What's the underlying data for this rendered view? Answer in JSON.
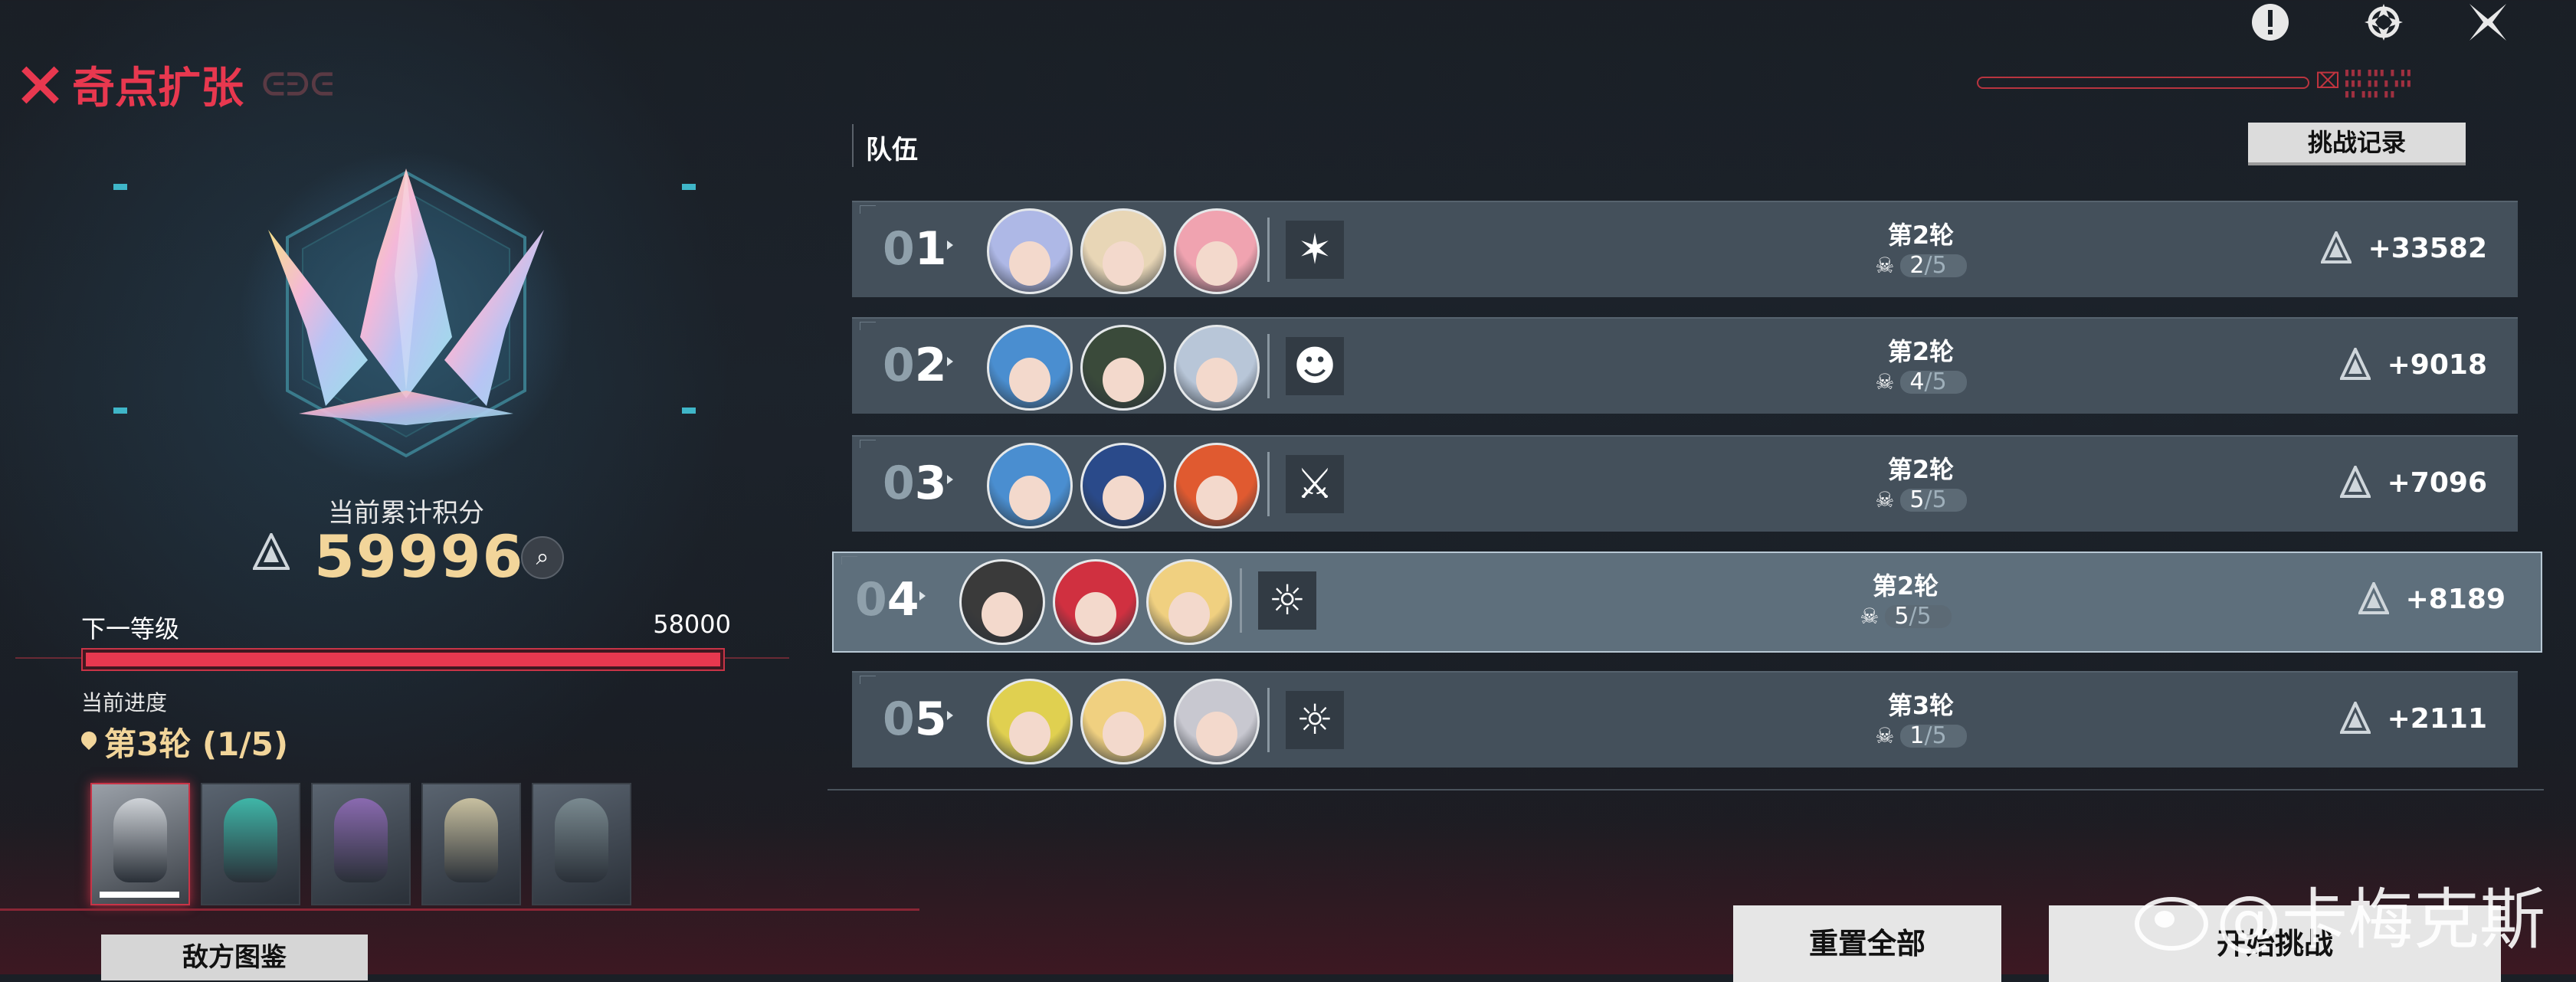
{
  "header": {
    "title": "奇点扩张",
    "title_deco": "ᕮᕭᕮ",
    "icons": [
      "alert-icon",
      "crown-emblem-icon",
      "close-x-icon"
    ]
  },
  "score_panel": {
    "label": "当前累计积分",
    "value": "59996",
    "next_level_label": "下一等级",
    "next_level_value": "58000",
    "bar_progress": 1.0,
    "progress_label": "当前进度",
    "progress_value": "第3轮 (1/5)"
  },
  "enemies": {
    "count": 5,
    "selected_index": 0,
    "button_label": "敌方图鉴"
  },
  "team": {
    "label": "队伍",
    "record_button": "挑战记录",
    "rows": [
      {
        "num_first": "0",
        "num_second": "1",
        "round": "第2轮",
        "stage": "2",
        "stage_total": "/5",
        "score": "+33582",
        "mode_icon": "burst-icon",
        "avatar_colors": [
          "#aeb8e6",
          "#e8d6b6",
          "#f0a3b0"
        ]
      },
      {
        "num_first": "0",
        "num_second": "2",
        "round": "第2轮",
        "stage": "4",
        "stage_total": "/5",
        "score": "+9018",
        "mode_icon": "demon-icon",
        "avatar_colors": [
          "#4a8ed0",
          "#3a4a3a",
          "#b8c6d8"
        ]
      },
      {
        "num_first": "0",
        "num_second": "3",
        "round": "第2轮",
        "stage": "5",
        "stage_total": "/5",
        "score": "+7096",
        "mode_icon": "crossed-swords-icon",
        "avatar_colors": [
          "#4a8ed0",
          "#2a4a8a",
          "#e05a30"
        ]
      },
      {
        "num_first": "0",
        "num_second": "4",
        "round": "第2轮",
        "stage": "5",
        "stage_total": "/5",
        "score": "+8189",
        "mode_icon": "sun-up-icon",
        "avatar_colors": [
          "#3a3a3a",
          "#d03040",
          "#f0d080"
        ]
      },
      {
        "num_first": "0",
        "num_second": "5",
        "round": "第3轮",
        "stage": "1",
        "stage_total": "/5",
        "score": "+2111",
        "mode_icon": "sun-up-icon",
        "avatar_colors": [
          "#e0d050",
          "#f0d080",
          "#c8c8d0"
        ]
      }
    ],
    "selected_row": 3
  },
  "actions": {
    "reset_all": "重置全部",
    "start_challenge": "开始挑战"
  },
  "watermark": "@卡梅克斯",
  "colors": {
    "accent_red": "#e8384f",
    "gold": "#f2d59a",
    "row_bg": "#44505b",
    "row_selected_bg": "#5e6f7c"
  }
}
